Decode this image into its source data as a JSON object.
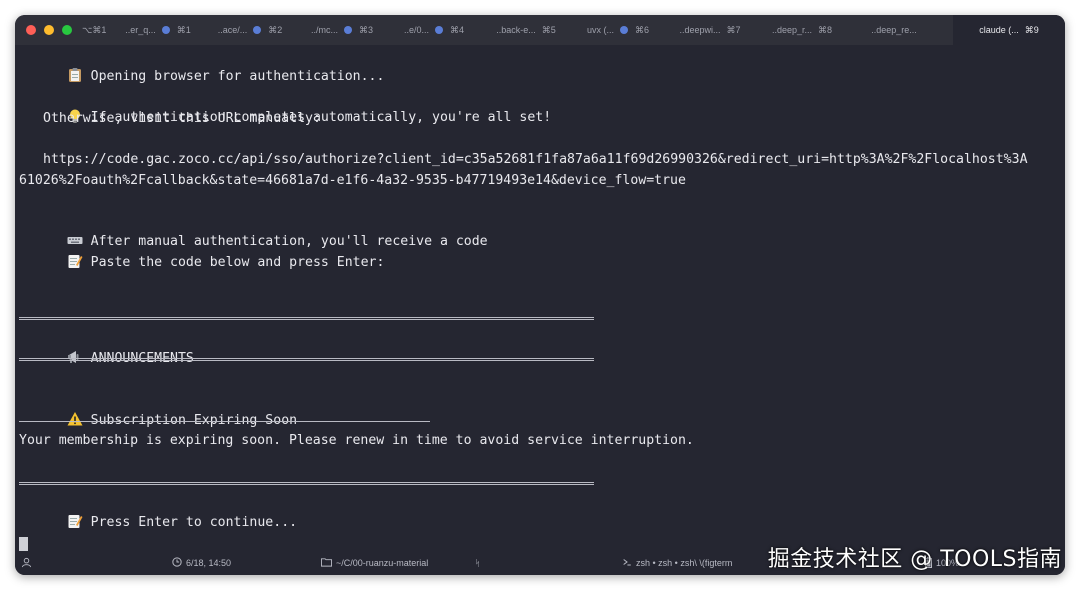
{
  "window": {
    "traffic_lights": {
      "close": "#fe5f57",
      "minimize": "#febc2e",
      "maximize": "#28c840"
    },
    "tabs": [
      {
        "label": "⌥⌘1",
        "shortcut": "",
        "has_dot": false,
        "active": false
      },
      {
        "label": "..er_q...",
        "shortcut": "⌘1",
        "has_dot": true,
        "active": false
      },
      {
        "label": "..ace/...",
        "shortcut": "⌘2",
        "has_dot": true,
        "active": false
      },
      {
        "label": "../mc...",
        "shortcut": "⌘3",
        "has_dot": true,
        "active": false
      },
      {
        "label": "..e/0...",
        "shortcut": "⌘4",
        "has_dot": true,
        "active": false
      },
      {
        "label": "..back-e...",
        "shortcut": "⌘5",
        "has_dot": false,
        "active": false
      },
      {
        "label": "uvx (...",
        "shortcut": "⌘6",
        "has_dot": true,
        "active": false
      },
      {
        "label": "..deepwi...",
        "shortcut": "⌘7",
        "has_dot": false,
        "active": false
      },
      {
        "label": "..deep_r...",
        "shortcut": "⌘8",
        "has_dot": false,
        "active": false
      },
      {
        "label": "..deep_re...",
        "shortcut": "",
        "has_dot": false,
        "active": false
      },
      {
        "label": "claude (...",
        "shortcut": "⌘9",
        "has_dot": false,
        "active": true
      }
    ]
  },
  "terminal": {
    "opening": "Opening browser for authentication...",
    "auto_complete": "If authentication completes automatically, you're all set!",
    "otherwise": "Otherwise, visit this URL manually:",
    "url_line1": "https://code.gac.zoco.cc/api/sso/authorize?client_id=c35a52681f1fa87a6a11f69d26990326&redirect_uri=http%3A%2F%2Flocalhost%3A",
    "url_line2": "61026%2Foauth%2Fcallback&state=46681a7d-e1f6-4a32-9535-b47719493e14&device_flow=true",
    "after_manual": "After manual authentication, you'll receive a code",
    "paste_code": "Paste the code below and press Enter:",
    "announcements": "ANNOUNCEMENTS",
    "subscription_title": "Subscription Expiring Soon",
    "subscription_body": "Your membership is expiring soon. Please renew in time to avoid service interruption.",
    "press_enter": "Press Enter to continue..."
  },
  "statusbar": {
    "datetime": "6/18, 14:50",
    "path": "~/C/00-ruanzu-material",
    "git_icon": "ᛋ",
    "shells": "zsh • zsh • zsh\\ \\(figterm",
    "battery": "100%"
  },
  "watermark": "掘金技术社区 @ TOOLS指南"
}
